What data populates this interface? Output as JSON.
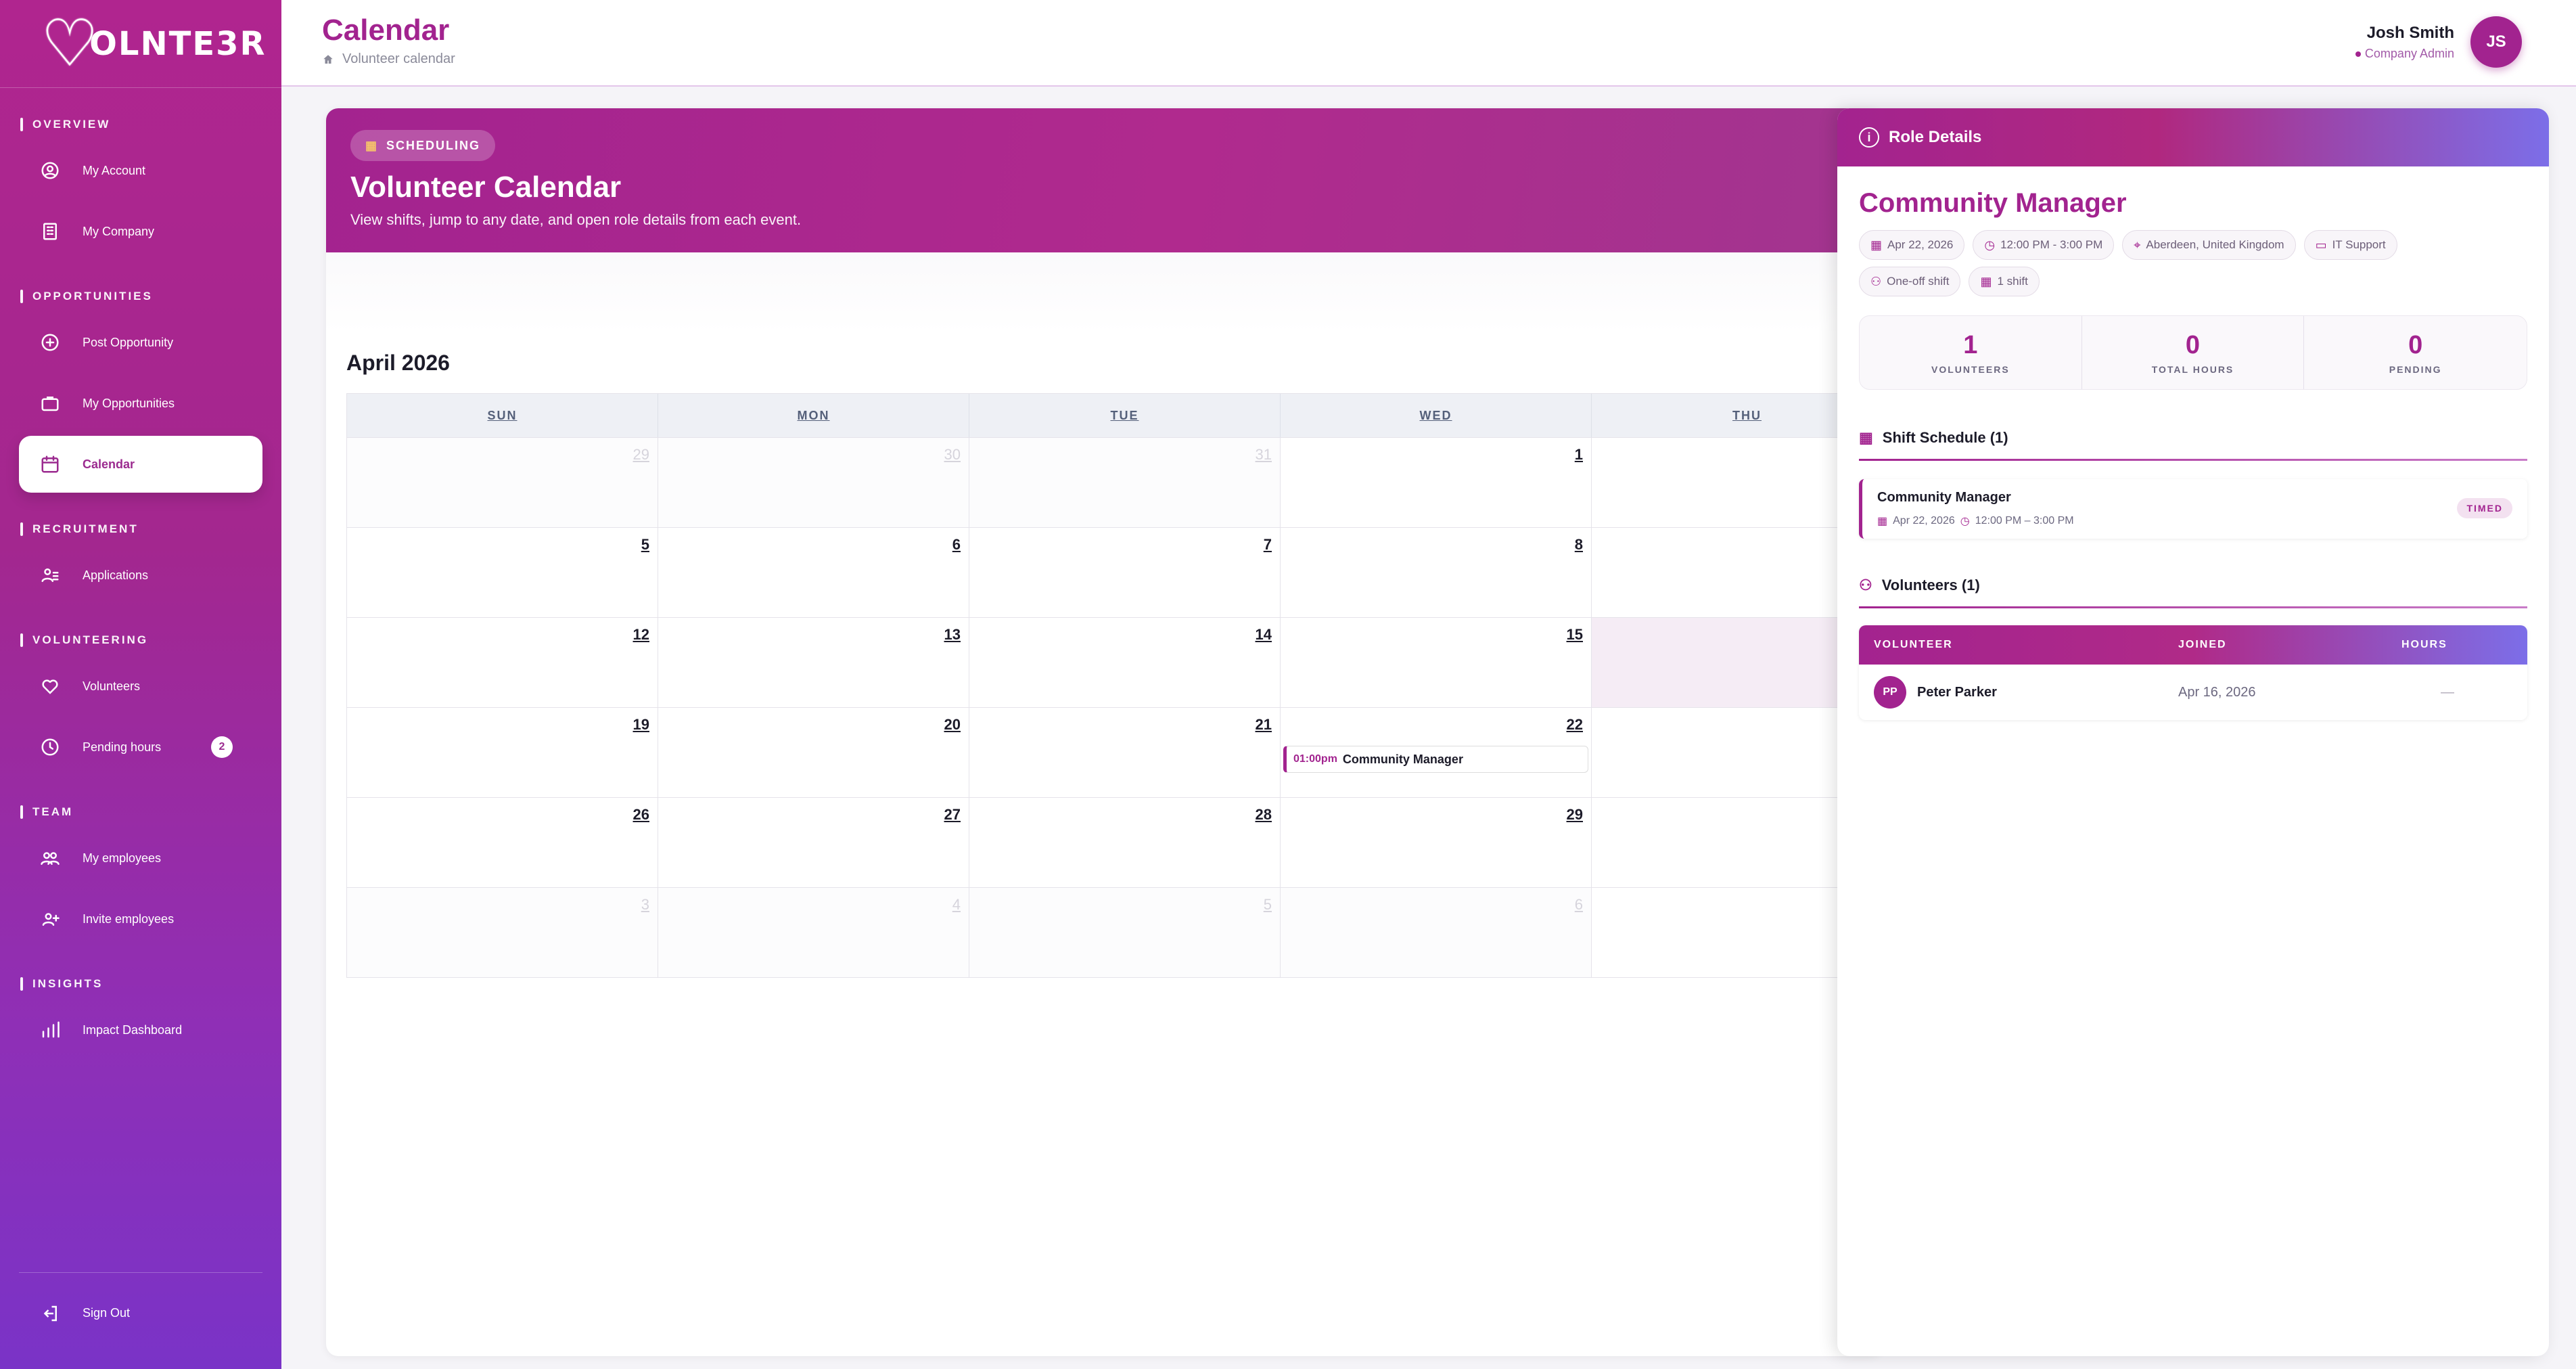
{
  "brand": {
    "logo_text": "OLNTE3R"
  },
  "sidebar": {
    "sections": [
      {
        "heading": "OVERVIEW",
        "items": [
          {
            "label": "My Account"
          },
          {
            "label": "My Company"
          }
        ]
      },
      {
        "heading": "OPPORTUNITIES",
        "items": [
          {
            "label": "Post Opportunity"
          },
          {
            "label": "My Opportunities"
          },
          {
            "label": "Calendar",
            "active": true
          }
        ]
      },
      {
        "heading": "RECRUITMENT",
        "items": [
          {
            "label": "Applications"
          }
        ]
      },
      {
        "heading": "VOLUNTEERING",
        "items": [
          {
            "label": "Volunteers"
          },
          {
            "label": "Pending hours",
            "badge": "2"
          }
        ]
      },
      {
        "heading": "TEAM",
        "items": [
          {
            "label": "My employees"
          },
          {
            "label": "Invite employees"
          }
        ]
      },
      {
        "heading": "INSIGHTS",
        "items": [
          {
            "label": "Impact Dashboard"
          }
        ]
      }
    ],
    "sign_out": "Sign Out"
  },
  "header": {
    "title": "Calendar",
    "breadcrumb": "Volunteer calendar",
    "user_name": "Josh Smith",
    "user_role": "Company Admin",
    "user_initials": "JS"
  },
  "hero": {
    "chip": "SCHEDULING",
    "title": "Volunteer Calendar",
    "subtitle": "View shifts, jump to any date, and open role details from each event."
  },
  "calendar": {
    "month": "April 2026",
    "weekdays": [
      "SUN",
      "MON",
      "TUE",
      "WED",
      "THU",
      "",
      ""
    ],
    "weeks": [
      [
        {
          "d": "29",
          "m": true
        },
        {
          "d": "30",
          "m": true
        },
        {
          "d": "31",
          "m": true
        },
        {
          "d": "1"
        },
        {
          "d": ""
        },
        {
          "d": ""
        },
        {
          "d": ""
        }
      ],
      [
        {
          "d": "5"
        },
        {
          "d": "6"
        },
        {
          "d": "7"
        },
        {
          "d": "8"
        },
        {
          "d": ""
        },
        {
          "d": ""
        },
        {
          "d": ""
        }
      ],
      [
        {
          "d": "12"
        },
        {
          "d": "13"
        },
        {
          "d": "14"
        },
        {
          "d": "15"
        },
        {
          "d": "",
          "today": true
        },
        {
          "d": ""
        },
        {
          "d": ""
        }
      ],
      [
        {
          "d": "19"
        },
        {
          "d": "20"
        },
        {
          "d": "21"
        },
        {
          "d": "22",
          "event": {
            "time": "01:00pm",
            "title": "Community Manager"
          }
        },
        {
          "d": ""
        },
        {
          "d": ""
        },
        {
          "d": ""
        }
      ],
      [
        {
          "d": "26"
        },
        {
          "d": "27"
        },
        {
          "d": "28"
        },
        {
          "d": "29"
        },
        {
          "d": ""
        },
        {
          "d": ""
        },
        {
          "d": ""
        }
      ],
      [
        {
          "d": "3",
          "m": true
        },
        {
          "d": "4",
          "m": true
        },
        {
          "d": "5",
          "m": true
        },
        {
          "d": "6",
          "m": true
        },
        {
          "d": ""
        },
        {
          "d": ""
        },
        {
          "d": ""
        }
      ]
    ]
  },
  "panel": {
    "header": "Role Details",
    "role_title": "Community Manager",
    "chips_row1": [
      {
        "icon": "calendar-icon",
        "label": "Apr 22, 2026"
      },
      {
        "icon": "clock-icon",
        "label": "12:00 PM - 3:00 PM"
      },
      {
        "icon": "location-pin-icon",
        "label": "Aberdeen, United Kingdom"
      },
      {
        "icon": "briefcase-icon",
        "label": "IT Support"
      }
    ],
    "chips_row2": [
      {
        "icon": "shift-type-icon",
        "label": "One-off shift"
      },
      {
        "icon": "calendar-icon",
        "label": "1 shift"
      }
    ],
    "stats": [
      {
        "value": "1",
        "label": "VOLUNTEERS"
      },
      {
        "value": "0",
        "label": "TOTAL HOURS"
      },
      {
        "value": "0",
        "label": "PENDING"
      }
    ],
    "shift_section": "Shift Schedule (1)",
    "shift": {
      "name": "Community Manager",
      "date": "Apr 22, 2026",
      "time": "12:00 PM – 3:00 PM",
      "tag": "TIMED"
    },
    "volunteers_section": "Volunteers (1)",
    "table": {
      "headers": [
        "VOLUNTEER",
        "JOINED",
        "HOURS"
      ],
      "rows": [
        {
          "initials": "PP",
          "name": "Peter Parker",
          "joined": "Apr 16, 2026",
          "hours": "—"
        }
      ]
    }
  },
  "colors": {
    "accent": "#a2238f",
    "accent_end": "#7c6ee8"
  }
}
